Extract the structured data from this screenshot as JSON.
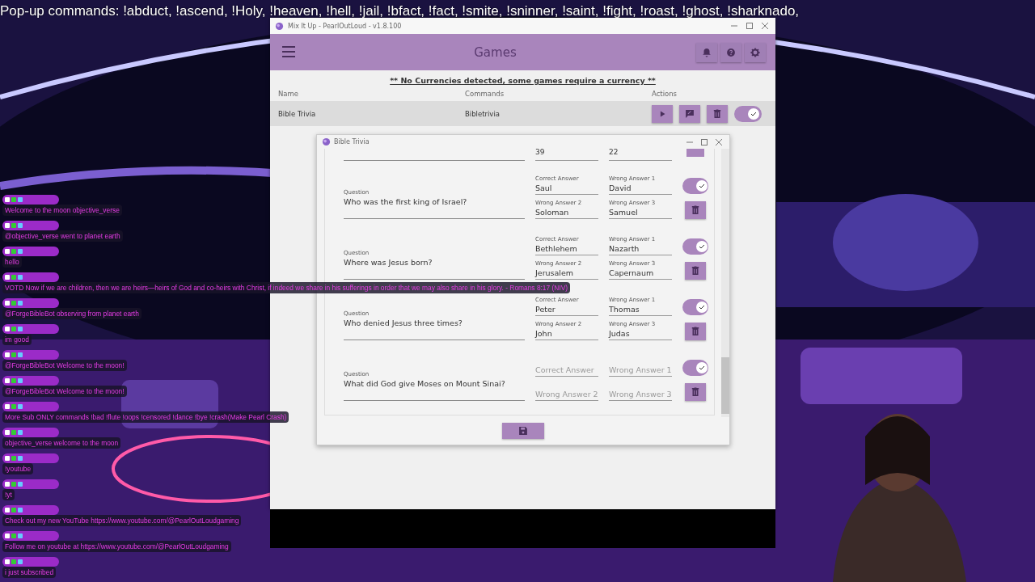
{
  "ticker": "Pop-up commands: !abduct, !ascend, !Holy, !heaven, !hell, !jail, !bfact, !fact, !smite, !sninner, !saint, !fight, !roast, !ghost, !sharknado,",
  "app_window": {
    "title": "Mix It Up - PearlOutLoud - v1.8.100",
    "header_title": "Games",
    "notice": "** No Currencies detected, some games require a currency **",
    "columns": [
      "Name",
      "Commands",
      "Actions"
    ],
    "rows": [
      {
        "name": "Bible Trivia",
        "command": "Bibletrivia",
        "enabled": true
      }
    ]
  },
  "dialog": {
    "title": "Bible Trivia",
    "partial_row": [
      "39",
      "22"
    ],
    "questions": [
      {
        "question_label": "Question",
        "question": "Who was the first king of Israel?",
        "enabled": true,
        "answers": [
          {
            "label": "Correct Answer",
            "value": "Saul"
          },
          {
            "label": "Wrong Answer 1",
            "value": "David"
          },
          {
            "label": "Wrong Answer 2",
            "value": "Soloman"
          },
          {
            "label": "Wrong Answer 3",
            "value": "Samuel"
          }
        ]
      },
      {
        "question_label": "Question",
        "question": "Where was Jesus born?",
        "enabled": true,
        "answers": [
          {
            "label": "Correct Answer",
            "value": "Bethlehem"
          },
          {
            "label": "Wrong Answer 1",
            "value": "Nazarth"
          },
          {
            "label": "Wrong Answer 2",
            "value": "Jerusalem"
          },
          {
            "label": "Wrong Answer 3",
            "value": "Capernaum"
          }
        ]
      },
      {
        "question_label": "Question",
        "question": "Who denied Jesus three times?",
        "enabled": true,
        "answers": [
          {
            "label": "Correct Answer",
            "value": "Peter"
          },
          {
            "label": "Wrong Answer 1",
            "value": "Thomas"
          },
          {
            "label": "Wrong Answer 2",
            "value": "John"
          },
          {
            "label": "Wrong Answer 3",
            "value": "Judas"
          }
        ]
      },
      {
        "question_label": "Question",
        "question": "What did God give Moses on Mount Sinai?",
        "enabled": true,
        "answers": [
          {
            "placeholder": "Correct Answer"
          },
          {
            "placeholder": "Wrong Answer 1"
          },
          {
            "placeholder": "Wrong Answer 2"
          },
          {
            "placeholder": "Wrong Answer 3"
          }
        ]
      }
    ]
  },
  "chat": {
    "messages": [
      {
        "text": "Welcome to the moon objective_verse"
      },
      {
        "text": "@objective_verse went to planet earth"
      },
      {
        "text": "hello"
      },
      {
        "text": "VOTD Now if we are children, then we are heirs—heirs of God and co-heirs with Christ, if indeed we share in his sufferings in order that we may also share in his glory. - Romans 8:17 (NIV)"
      },
      {
        "text": "@ForgeBibleBot observing from planet earth"
      },
      {
        "text": "im good"
      },
      {
        "text": "@ForgeBibleBot Welcome to the moon!"
      },
      {
        "text": "@ForgeBibleBot Welcome to the moon!"
      },
      {
        "text": "More Sub ONLY commands !bad !flute !oops !censored !dance !bye !crash(Make Pearl Crash)"
      },
      {
        "text": "objective_verse welcome to the moon"
      },
      {
        "text": "!youtube"
      },
      {
        "text": "!yt"
      },
      {
        "text": "Check out my new YouTube https://www.youtube.com/@PearlOutLoudgaming"
      },
      {
        "text": "Follow me on youtube at https://www.youtube.com/@PearlOutLoudgaming"
      },
      {
        "text": "i just subscribed"
      }
    ]
  }
}
